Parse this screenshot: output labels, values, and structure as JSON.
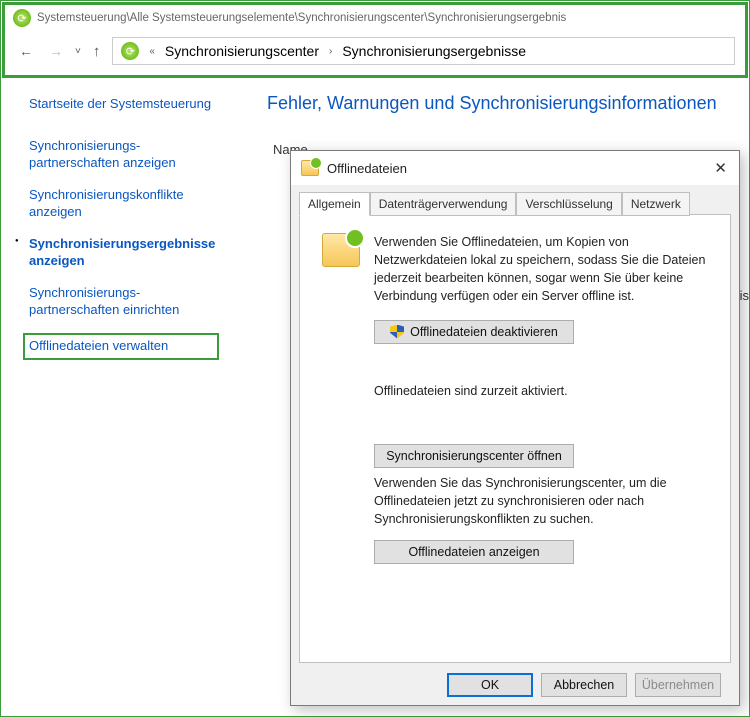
{
  "path_text": "Systemsteuerung\\Alle Systemsteuerungselemente\\Synchronisierungscenter\\Synchronisierungsergebnis",
  "breadcrumb": {
    "level1": "Synchronisierungscenter",
    "level2": "Synchronisierungsergebnisse"
  },
  "sidebar": {
    "home": "Startseite der Systemsteuerung",
    "items": [
      "Synchronisierungs-\npartnerschaften anzeigen",
      "Synchronisierungskonflikte anzeigen",
      "Synchronisierungsergebnisse anzeigen",
      "Synchronisierungs-\npartnerschaften einrichten",
      "Offlinedateien verwalten"
    ]
  },
  "main": {
    "title": "Fehler, Warnungen und Synchronisierungsinformationen",
    "name_col": "Name",
    "partial_label": "is"
  },
  "dialog": {
    "title": "Offlinedateien",
    "tabs": [
      "Allgemein",
      "Datenträgerverwendung",
      "Verschlüsselung",
      "Netzwerk"
    ],
    "desc": "Verwenden Sie Offlinedateien, um Kopien von Netzwerkdateien lokal zu speichern, sodass Sie die Dateien jederzeit bearbeiten können, sogar wenn Sie über keine Verbindung verfügen oder ein Server offline ist.",
    "btn_deactivate": "Offlinedateien deaktivieren",
    "status": "Offlinedateien sind zurzeit aktiviert.",
    "btn_open_center": "Synchronisierungscenter öffnen",
    "center_desc": "Verwenden Sie das Synchronisierungscenter, um die Offlinedateien jetzt zu synchronisieren oder nach Synchronisierungskonflikten zu suchen.",
    "btn_view": "Offlinedateien anzeigen",
    "ok": "OK",
    "cancel": "Abbrechen",
    "apply": "Übernehmen"
  }
}
